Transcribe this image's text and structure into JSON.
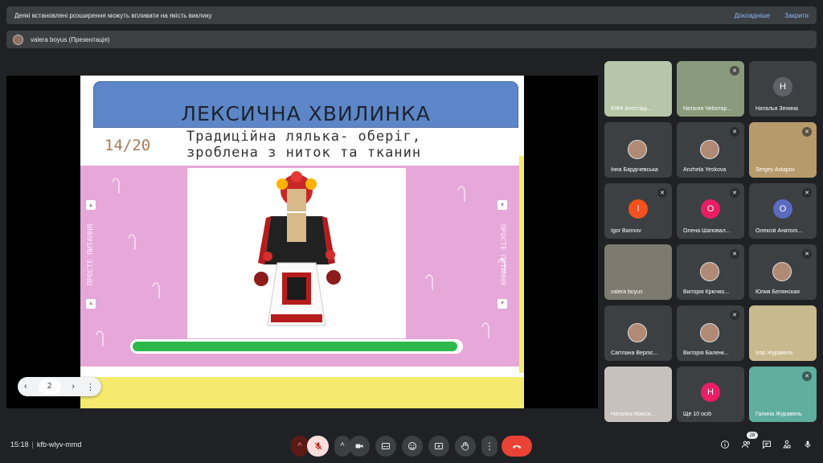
{
  "banner": {
    "message": "Деякі встановлені розширення можуть впливати на якість виклику",
    "details": "Докладніше",
    "close": "Закрити"
  },
  "presenter": {
    "label": "valera boyus (Презентація)"
  },
  "slide": {
    "title": "ЛЕКСИЧНА ХВИЛИНКА",
    "counter": "14/20",
    "question_line1": "Традиційна лялька- оберіг,",
    "question_line2": "зроблена з ниток та тканин",
    "side_text": "ПРОСТЕ ПИТАННЯ",
    "progress": 0.99
  },
  "pager": {
    "prev": "‹",
    "page": "2",
    "next": "›",
    "more": "⋮"
  },
  "participants": [
    {
      "name": "КІФК Атестаці...",
      "initial": "",
      "muted": false,
      "color": ""
    },
    {
      "name": "Наталія Чеботар...",
      "initial": "",
      "muted": true,
      "color": ""
    },
    {
      "name": "Наталья Зенина",
      "initial": "Н",
      "muted": false,
      "color": "#5f6368"
    },
    {
      "name": "Інна Бардічевська",
      "initial": "",
      "muted": false,
      "color": ""
    },
    {
      "name": "Anzhela Yeskova",
      "initial": "",
      "muted": true,
      "color": ""
    },
    {
      "name": "Sergey Astapov",
      "initial": "",
      "muted": true,
      "color": ""
    },
    {
      "name": "Igor Barinov",
      "initial": "I",
      "muted": true,
      "color": "#f4511e"
    },
    {
      "name": "Олена Шаповал...",
      "initial": "О",
      "muted": true,
      "color": "#e91e63"
    },
    {
      "name": "Олексій Анатолі...",
      "initial": "О",
      "muted": true,
      "color": "#5c6bc0"
    },
    {
      "name": "valera boyus",
      "initial": "",
      "muted": false,
      "color": ""
    },
    {
      "name": "Вікторія Крючко...",
      "initial": "",
      "muted": true,
      "color": ""
    },
    {
      "name": "Юлия Белянская",
      "initial": "",
      "muted": true,
      "color": ""
    },
    {
      "name": "Саітлана Верліс...",
      "initial": "",
      "muted": false,
      "color": ""
    },
    {
      "name": "Вікторія Баленк...",
      "initial": "",
      "muted": true,
      "color": ""
    },
    {
      "name": "Ігор Журавель",
      "initial": "",
      "muted": false,
      "color": ""
    },
    {
      "name": "Наталка Макси...",
      "initial": "",
      "muted": false,
      "color": ""
    },
    {
      "name": "Ще 10 осіб",
      "initial": "Н",
      "muted": false,
      "color": "#e91e63"
    },
    {
      "name": "Галина Журавель",
      "initial": "",
      "muted": true,
      "color": ""
    }
  ],
  "footer": {
    "time": "15:18",
    "meeting_code": "kfb-wlyv-mmd",
    "participants_count": "28"
  },
  "icons": {
    "mic_off": "mic-off-icon",
    "camera": "camera-icon",
    "captions": "captions-icon",
    "emoji": "emoji-icon",
    "present": "present-icon",
    "hand": "raise-hand-icon",
    "more": "more-icon",
    "end": "end-call-icon",
    "info": "info-icon",
    "people": "people-icon",
    "chat": "chat-icon",
    "activities": "activities-icon",
    "host": "host-controls-icon"
  },
  "colors": {
    "end_call": "#ea4335",
    "mic_off_bg": "#f9dedc",
    "accent": "#8ab4f8"
  }
}
